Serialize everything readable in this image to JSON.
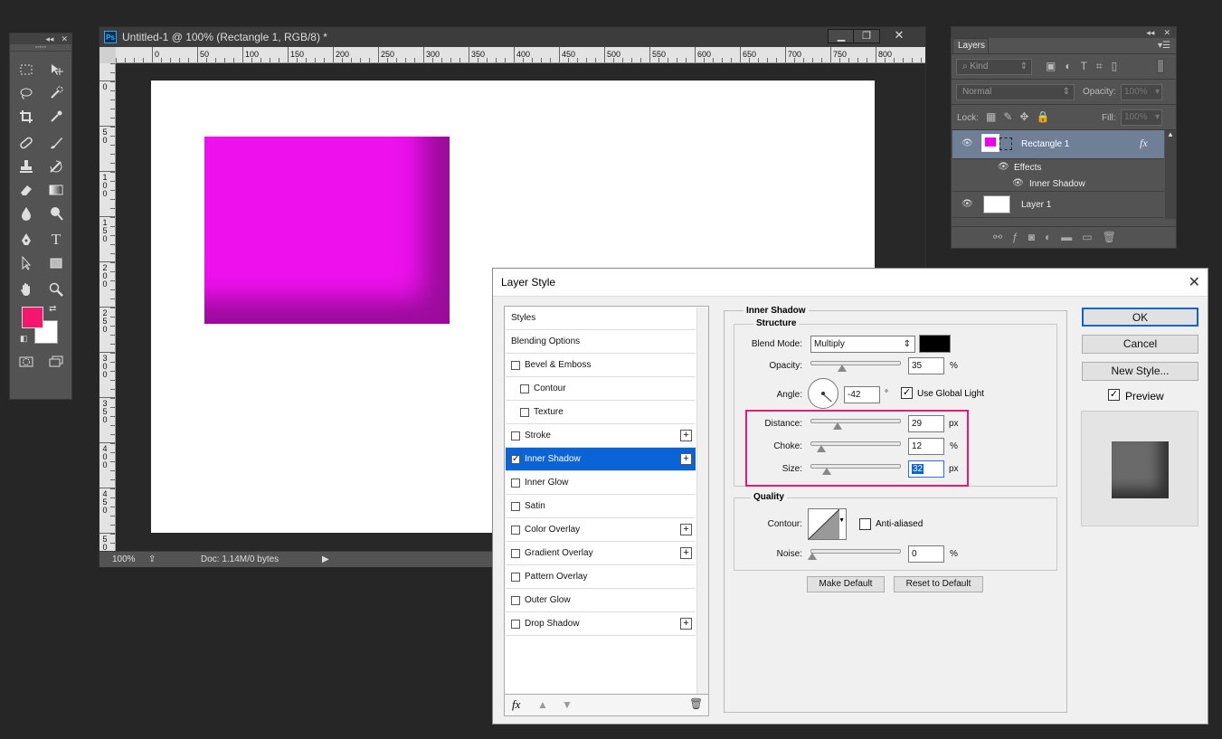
{
  "document": {
    "title": "Untitled-1 @ 100% (Rectangle 1, RGB/8) *",
    "ps_badge": "Ps",
    "zoom": "100%",
    "doc_info": "Doc: 1.14M/0 bytes",
    "ruler_h": [
      "0",
      "50",
      "100",
      "150",
      "200",
      "250",
      "300",
      "350",
      "400",
      "450",
      "500",
      "550",
      "600",
      "650",
      "700",
      "750",
      "800"
    ],
    "ruler_v": [
      "0",
      "50",
      "100",
      "150",
      "200",
      "250",
      "300",
      "350",
      "400",
      "450",
      "500"
    ],
    "foreground_color": "#f5166e",
    "background_color": "#ffffff",
    "shape_color": "#ee11ee"
  },
  "layers_panel": {
    "tab": "Layers",
    "filter_kind": "Kind",
    "blend_mode": "Normal",
    "opacity_label": "Opacity:",
    "opacity_value": "100%",
    "lock_label": "Lock:",
    "fill_label": "Fill:",
    "fill_value": "100%",
    "layers": [
      {
        "name": "Rectangle 1",
        "fx": "fx"
      },
      {
        "name": "Effects"
      },
      {
        "name": "Inner Shadow"
      },
      {
        "name": "Layer 1"
      }
    ]
  },
  "dialog": {
    "title": "Layer Style",
    "styles_list": [
      {
        "label": "Styles"
      },
      {
        "label": "Blending Options"
      },
      {
        "label": "Bevel & Emboss"
      },
      {
        "label": "Contour"
      },
      {
        "label": "Texture"
      },
      {
        "label": "Stroke"
      },
      {
        "label": "Inner Shadow"
      },
      {
        "label": "Inner Glow"
      },
      {
        "label": "Satin"
      },
      {
        "label": "Color Overlay"
      },
      {
        "label": "Gradient Overlay"
      },
      {
        "label": "Pattern Overlay"
      },
      {
        "label": "Outer Glow"
      },
      {
        "label": "Drop Shadow"
      }
    ],
    "section_title": "Inner Shadow",
    "structure_title": "Structure",
    "blend_mode_label": "Blend Mode:",
    "blend_mode_value": "Multiply",
    "shadow_color": "#000000",
    "opacity_label": "Opacity:",
    "opacity_value": "35",
    "opacity_unit": "%",
    "angle_label": "Angle:",
    "angle_value": "-42",
    "angle_unit": "°",
    "global_light_label": "Use Global Light",
    "distance_label": "Distance:",
    "distance_value": "29",
    "distance_unit": "px",
    "choke_label": "Choke:",
    "choke_value": "12",
    "choke_unit": "%",
    "size_label": "Size:",
    "size_value": "32",
    "size_unit": "px",
    "quality_title": "Quality",
    "contour_label": "Contour:",
    "anti_aliased_label": "Anti-aliased",
    "noise_label": "Noise:",
    "noise_value": "0",
    "noise_unit": "%",
    "make_default": "Make Default",
    "reset_default": "Reset to Default",
    "ok": "OK",
    "cancel": "Cancel",
    "new_style": "New Style...",
    "preview_label": "Preview",
    "fx_label": "fx",
    "highlight_color": "#e8196e"
  }
}
